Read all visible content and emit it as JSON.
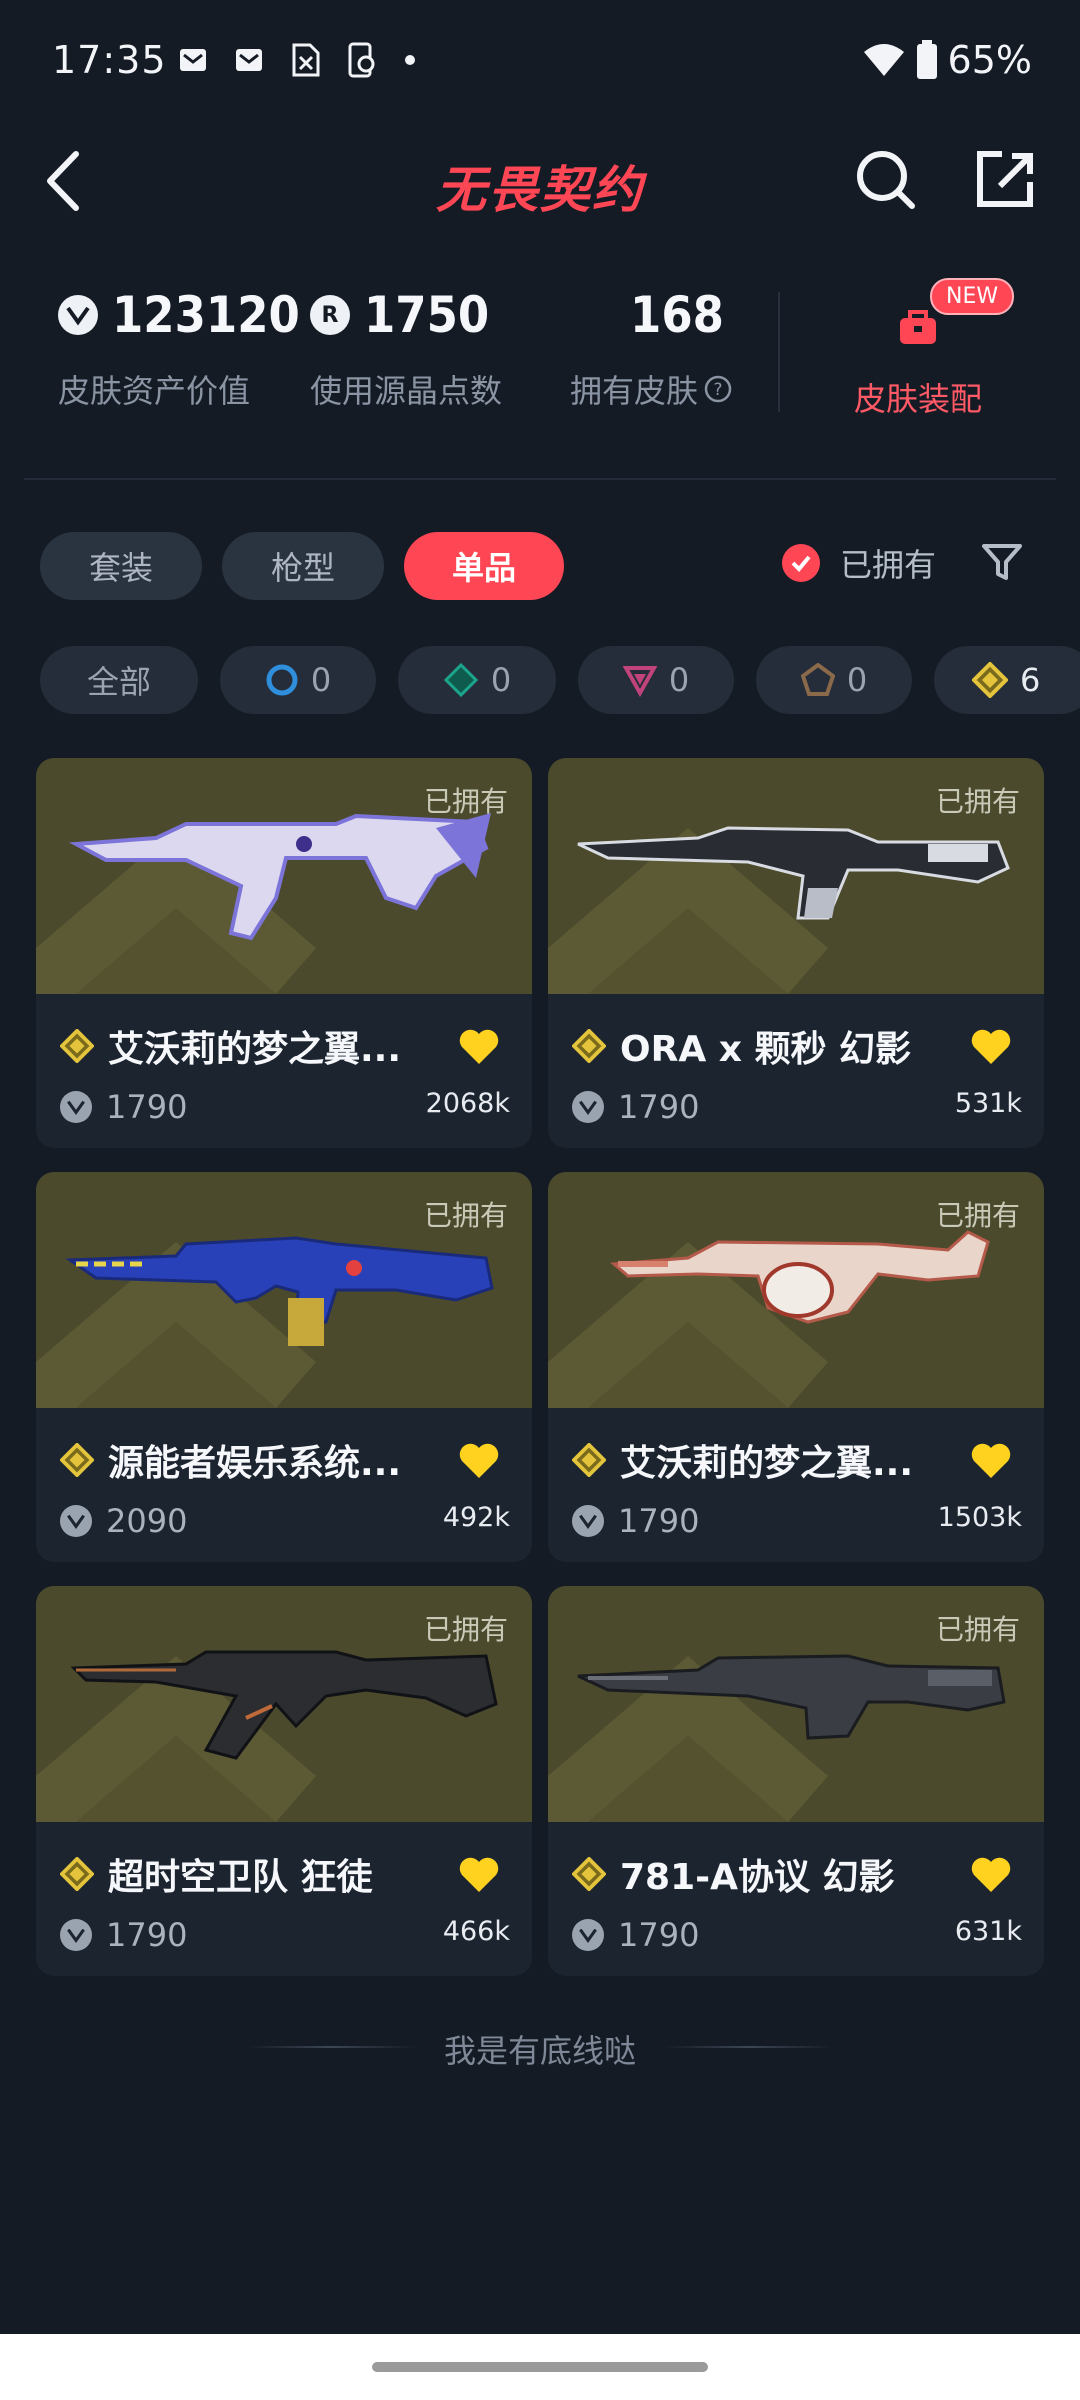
{
  "status_bar": {
    "time": "17:35",
    "battery": "65%"
  },
  "header": {
    "title": "无畏契约"
  },
  "stats": [
    {
      "value": "123120",
      "label": "皮肤资产价值",
      "icon": "vp-coin-icon"
    },
    {
      "value": "1750",
      "label": "使用源晶点数",
      "icon": "radianite-coin-icon"
    },
    {
      "value": "168",
      "label": "拥有皮肤",
      "icon": ""
    }
  ],
  "combo": {
    "badge": "NEW",
    "label": "皮肤装配"
  },
  "tabs": [
    {
      "label": "套装",
      "active": false
    },
    {
      "label": "枪型",
      "active": false
    },
    {
      "label": "单品",
      "active": true
    }
  ],
  "owned_filter": {
    "label": "已拥有",
    "checked": true
  },
  "rarity_chips": [
    {
      "label": "全部"
    },
    {
      "label": "0",
      "icon": "select-tier-icon",
      "color": "#2f8fdc"
    },
    {
      "label": "0",
      "icon": "deluxe-tier-icon",
      "color": "#1aa58c"
    },
    {
      "label": "0",
      "icon": "premium-tier-icon",
      "color": "#c0447b"
    },
    {
      "label": "0",
      "icon": "exclusive-tier-icon",
      "color": "#8b6a4c"
    },
    {
      "label": "6",
      "icon": "ultra-tier-icon",
      "color": "#e3c43c"
    }
  ],
  "cards": [
    {
      "owned": "已拥有",
      "name": "艾沃莉的梦之翼...",
      "price": "1790",
      "likes": "2068k"
    },
    {
      "owned": "已拥有",
      "name": "ORA x 颗秒 幻影",
      "price": "1790",
      "likes": "531k"
    },
    {
      "owned": "已拥有",
      "name": "源能者娱乐系统...",
      "price": "2090",
      "likes": "492k"
    },
    {
      "owned": "已拥有",
      "name": "艾沃莉的梦之翼...",
      "price": "1790",
      "likes": "1503k"
    },
    {
      "owned": "已拥有",
      "name": "超时空卫队 狂徒",
      "price": "1790",
      "likes": "466k"
    },
    {
      "owned": "已拥有",
      "name": "781-A协议 幻影",
      "price": "1790",
      "likes": "631k"
    }
  ],
  "footer": {
    "text": "我是有底线哒"
  },
  "colors": {
    "accent": "#ff4655",
    "background": "#141b25",
    "card": "#1c2430",
    "ultra_tier": "#e3c43c",
    "heart": "#ffd21f"
  }
}
